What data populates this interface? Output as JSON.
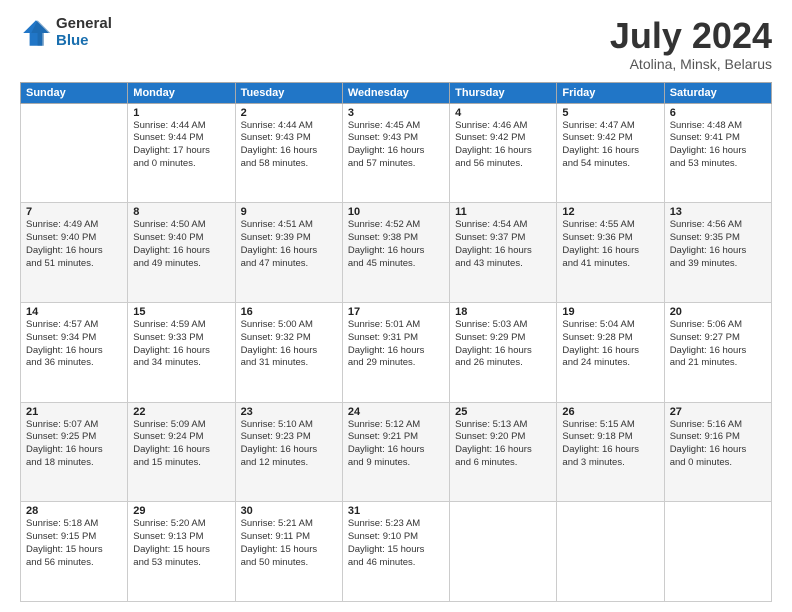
{
  "header": {
    "logo_general": "General",
    "logo_blue": "Blue",
    "month_title": "July 2024",
    "subtitle": "Atolina, Minsk, Belarus"
  },
  "days_of_week": [
    "Sunday",
    "Monday",
    "Tuesday",
    "Wednesday",
    "Thursday",
    "Friday",
    "Saturday"
  ],
  "weeks": [
    [
      {
        "day": "",
        "info": ""
      },
      {
        "day": "1",
        "info": "Sunrise: 4:44 AM\nSunset: 9:44 PM\nDaylight: 17 hours\nand 0 minutes."
      },
      {
        "day": "2",
        "info": "Sunrise: 4:44 AM\nSunset: 9:43 PM\nDaylight: 16 hours\nand 58 minutes."
      },
      {
        "day": "3",
        "info": "Sunrise: 4:45 AM\nSunset: 9:43 PM\nDaylight: 16 hours\nand 57 minutes."
      },
      {
        "day": "4",
        "info": "Sunrise: 4:46 AM\nSunset: 9:42 PM\nDaylight: 16 hours\nand 56 minutes."
      },
      {
        "day": "5",
        "info": "Sunrise: 4:47 AM\nSunset: 9:42 PM\nDaylight: 16 hours\nand 54 minutes."
      },
      {
        "day": "6",
        "info": "Sunrise: 4:48 AM\nSunset: 9:41 PM\nDaylight: 16 hours\nand 53 minutes."
      }
    ],
    [
      {
        "day": "7",
        "info": "Sunrise: 4:49 AM\nSunset: 9:40 PM\nDaylight: 16 hours\nand 51 minutes."
      },
      {
        "day": "8",
        "info": "Sunrise: 4:50 AM\nSunset: 9:40 PM\nDaylight: 16 hours\nand 49 minutes."
      },
      {
        "day": "9",
        "info": "Sunrise: 4:51 AM\nSunset: 9:39 PM\nDaylight: 16 hours\nand 47 minutes."
      },
      {
        "day": "10",
        "info": "Sunrise: 4:52 AM\nSunset: 9:38 PM\nDaylight: 16 hours\nand 45 minutes."
      },
      {
        "day": "11",
        "info": "Sunrise: 4:54 AM\nSunset: 9:37 PM\nDaylight: 16 hours\nand 43 minutes."
      },
      {
        "day": "12",
        "info": "Sunrise: 4:55 AM\nSunset: 9:36 PM\nDaylight: 16 hours\nand 41 minutes."
      },
      {
        "day": "13",
        "info": "Sunrise: 4:56 AM\nSunset: 9:35 PM\nDaylight: 16 hours\nand 39 minutes."
      }
    ],
    [
      {
        "day": "14",
        "info": "Sunrise: 4:57 AM\nSunset: 9:34 PM\nDaylight: 16 hours\nand 36 minutes."
      },
      {
        "day": "15",
        "info": "Sunrise: 4:59 AM\nSunset: 9:33 PM\nDaylight: 16 hours\nand 34 minutes."
      },
      {
        "day": "16",
        "info": "Sunrise: 5:00 AM\nSunset: 9:32 PM\nDaylight: 16 hours\nand 31 minutes."
      },
      {
        "day": "17",
        "info": "Sunrise: 5:01 AM\nSunset: 9:31 PM\nDaylight: 16 hours\nand 29 minutes."
      },
      {
        "day": "18",
        "info": "Sunrise: 5:03 AM\nSunset: 9:29 PM\nDaylight: 16 hours\nand 26 minutes."
      },
      {
        "day": "19",
        "info": "Sunrise: 5:04 AM\nSunset: 9:28 PM\nDaylight: 16 hours\nand 24 minutes."
      },
      {
        "day": "20",
        "info": "Sunrise: 5:06 AM\nSunset: 9:27 PM\nDaylight: 16 hours\nand 21 minutes."
      }
    ],
    [
      {
        "day": "21",
        "info": "Sunrise: 5:07 AM\nSunset: 9:25 PM\nDaylight: 16 hours\nand 18 minutes."
      },
      {
        "day": "22",
        "info": "Sunrise: 5:09 AM\nSunset: 9:24 PM\nDaylight: 16 hours\nand 15 minutes."
      },
      {
        "day": "23",
        "info": "Sunrise: 5:10 AM\nSunset: 9:23 PM\nDaylight: 16 hours\nand 12 minutes."
      },
      {
        "day": "24",
        "info": "Sunrise: 5:12 AM\nSunset: 9:21 PM\nDaylight: 16 hours\nand 9 minutes."
      },
      {
        "day": "25",
        "info": "Sunrise: 5:13 AM\nSunset: 9:20 PM\nDaylight: 16 hours\nand 6 minutes."
      },
      {
        "day": "26",
        "info": "Sunrise: 5:15 AM\nSunset: 9:18 PM\nDaylight: 16 hours\nand 3 minutes."
      },
      {
        "day": "27",
        "info": "Sunrise: 5:16 AM\nSunset: 9:16 PM\nDaylight: 16 hours\nand 0 minutes."
      }
    ],
    [
      {
        "day": "28",
        "info": "Sunrise: 5:18 AM\nSunset: 9:15 PM\nDaylight: 15 hours\nand 56 minutes."
      },
      {
        "day": "29",
        "info": "Sunrise: 5:20 AM\nSunset: 9:13 PM\nDaylight: 15 hours\nand 53 minutes."
      },
      {
        "day": "30",
        "info": "Sunrise: 5:21 AM\nSunset: 9:11 PM\nDaylight: 15 hours\nand 50 minutes."
      },
      {
        "day": "31",
        "info": "Sunrise: 5:23 AM\nSunset: 9:10 PM\nDaylight: 15 hours\nand 46 minutes."
      },
      {
        "day": "",
        "info": ""
      },
      {
        "day": "",
        "info": ""
      },
      {
        "day": "",
        "info": ""
      }
    ]
  ]
}
